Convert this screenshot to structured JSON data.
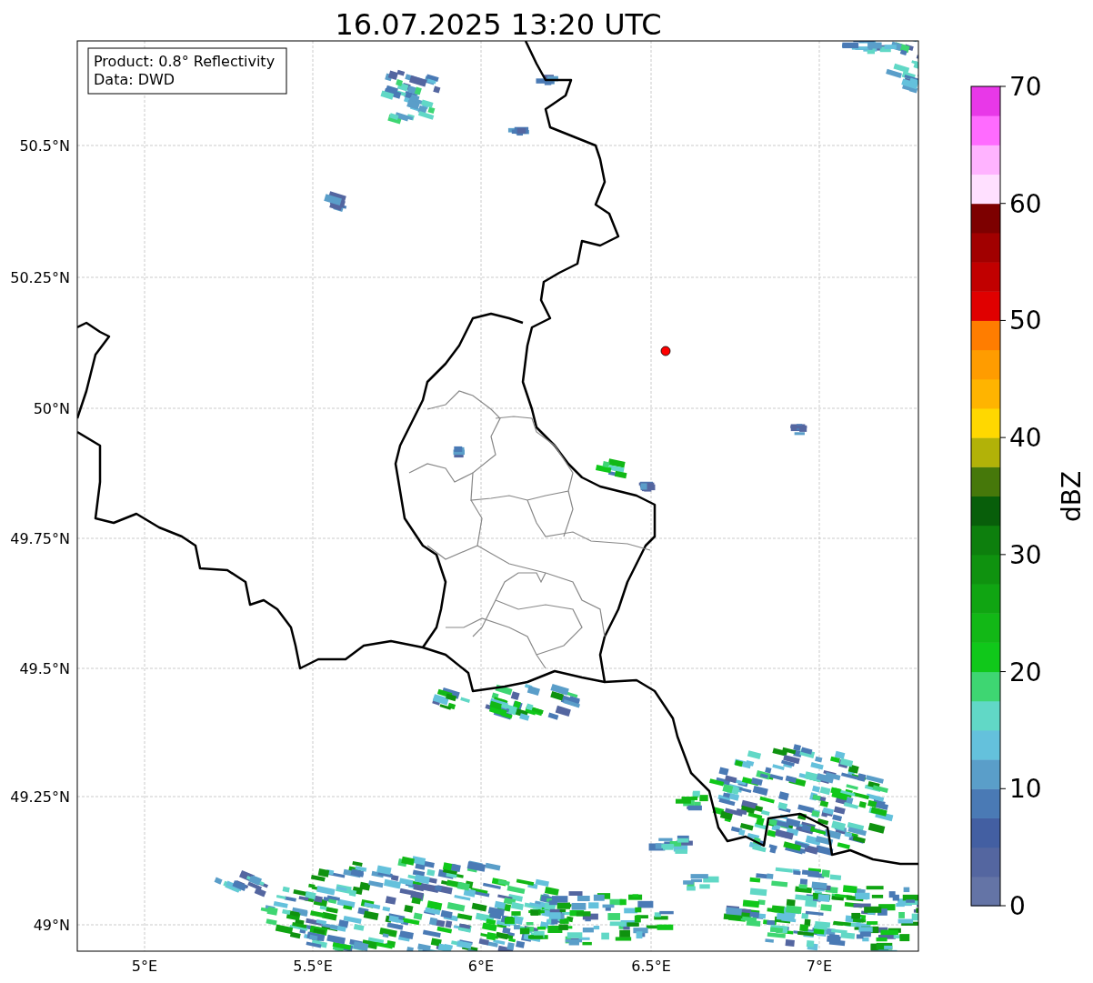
{
  "title": "16.07.2025 13:20 UTC",
  "legend": {
    "lines": [
      "Product: 0.8° Reflectivity",
      "Data: DWD"
    ]
  },
  "map": {
    "y_ticks": [
      {
        "label": "50.5°N"
      },
      {
        "label": "50.25°N"
      },
      {
        "label": "50°N"
      },
      {
        "label": "49.75°N"
      },
      {
        "label": "49.5°N"
      },
      {
        "label": "49.25°N"
      },
      {
        "label": "49°N"
      }
    ],
    "x_ticks": [
      {
        "label": "5°E"
      },
      {
        "label": "5.5°E"
      },
      {
        "label": "6°E"
      },
      {
        "label": "6.5°E"
      },
      {
        "label": "7°E"
      }
    ],
    "marker": {
      "color": "#ff0000"
    }
  },
  "colorbar": {
    "label": "dBZ",
    "ticks": [
      "70",
      "60",
      "50",
      "40",
      "30",
      "20",
      "10",
      "0"
    ],
    "bins": [
      {
        "color": "#6474a6"
      },
      {
        "color": "#5466a0"
      },
      {
        "color": "#435fa2"
      },
      {
        "color": "#4a7ab5"
      },
      {
        "color": "#5a9ec9"
      },
      {
        "color": "#64c1dc"
      },
      {
        "color": "#61d8c6"
      },
      {
        "color": "#3ed672"
      },
      {
        "color": "#10c81a"
      },
      {
        "color": "#12b816"
      },
      {
        "color": "#10a512"
      },
      {
        "color": "#0f920f"
      },
      {
        "color": "#0d7f0d"
      },
      {
        "color": "#085e0a"
      },
      {
        "color": "#46780a"
      },
      {
        "color": "#b2b208"
      },
      {
        "color": "#ffd800"
      },
      {
        "color": "#ffb400"
      },
      {
        "color": "#ff9c00"
      },
      {
        "color": "#ff7d00"
      },
      {
        "color": "#e00000"
      },
      {
        "color": "#c10000"
      },
      {
        "color": "#a10000"
      },
      {
        "color": "#7d0000"
      },
      {
        "color": "#ffe0ff"
      },
      {
        "color": "#ffb3ff"
      },
      {
        "color": "#ff6bff"
      },
      {
        "color": "#e838e8"
      }
    ]
  }
}
